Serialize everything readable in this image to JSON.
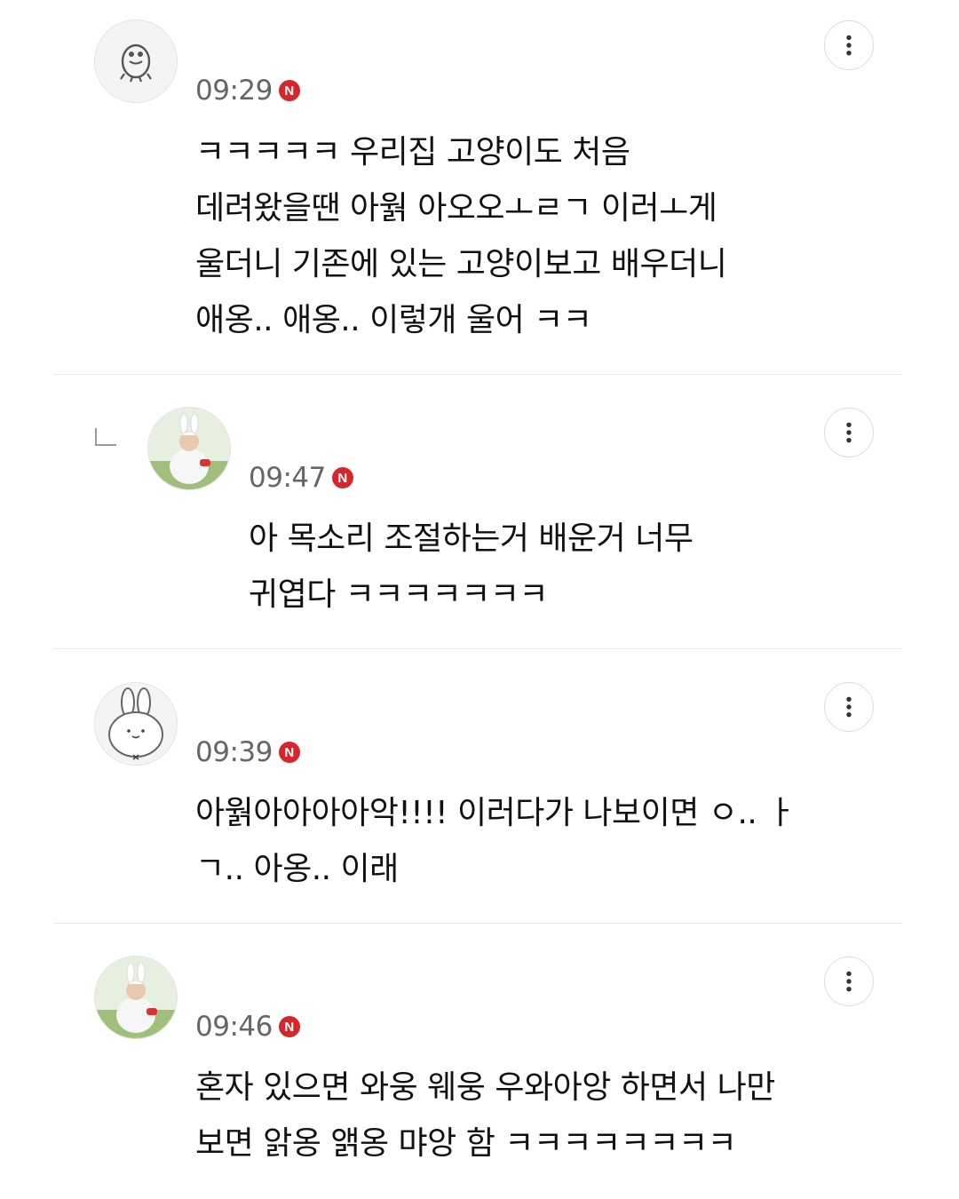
{
  "comments": [
    {
      "time": "09:29",
      "badge": "N",
      "avatar": "cartoon-avatar-icon",
      "lines": [
        "ㅋㅋㅋㅋㅋ 우리집 고양이도 처음",
        "데려왔을땐 아웕 아오오ㅗㄹㄱ 이러ㅗ게",
        "울더니 기존에 있는 고양이보고 배우더니",
        "애옹.. 애옹.. 이렇개 울어 ㅋㅋ"
      ]
    },
    {
      "time": "09:47",
      "badge": "N",
      "avatar": "bunny-costume-photo",
      "reply": true,
      "lines": [
        "아 목소리 조절하는거 배운거 너무",
        "귀엽다 ㅋㅋㅋㅋㅋㅋㅋ"
      ]
    },
    {
      "time": "09:39",
      "badge": "N",
      "avatar": "bunny-sketch-icon",
      "lines": [
        "아웕아아아아악!!!! 이러다가 나보이면 ㅇ.. ㅏ",
        "ㄱ.. 아옹.. 이래"
      ]
    },
    {
      "time": "09:46",
      "badge": "N",
      "avatar": "bunny-costume-photo",
      "lines": [
        "혼자 있으면 와웅 웨웅 우와아앙 하면서 나만",
        "보면 앍옹 앩옹 먀앙 함 ㅋㅋㅋㅋㅋㅋㅋㅋ"
      ]
    }
  ],
  "colors": {
    "badge": "#d6262c",
    "time": "#666666",
    "divider": "#e6e6e6"
  }
}
